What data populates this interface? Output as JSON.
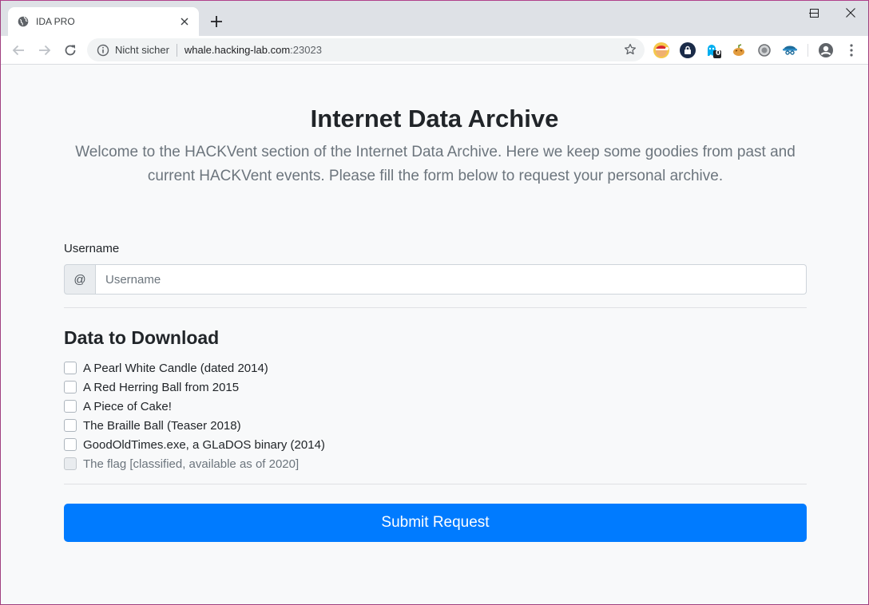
{
  "browser": {
    "tab_title": "IDA PRO",
    "security_label": "Nicht sicher",
    "url_host": "whale.hacking-lab.com",
    "url_port": ":23023",
    "extension_badge": "0"
  },
  "page": {
    "title": "Internet Data Archive",
    "lead": "Welcome to the HACKVent section of the Internet Data Archive. Here we keep some goodies from past and current HACKVent events. Please fill the form below to request your personal archive.",
    "username_label": "Username",
    "username_prepend": "@",
    "username_placeholder": "Username",
    "username_value": "",
    "download_heading": "Data to Download",
    "items": [
      {
        "label": "A Pearl White Candle (dated 2014)",
        "checked": false,
        "disabled": false
      },
      {
        "label": "A Red Herring Ball from 2015",
        "checked": false,
        "disabled": false
      },
      {
        "label": "A Piece of Cake!",
        "checked": false,
        "disabled": false
      },
      {
        "label": "The Braille Ball (Teaser 2018)",
        "checked": false,
        "disabled": false
      },
      {
        "label": "GoodOldTimes.exe, a GLaDOS binary (2014)",
        "checked": false,
        "disabled": false
      },
      {
        "label": "The flag [classified, available as of 2020]",
        "checked": false,
        "disabled": true
      }
    ],
    "submit_label": "Submit Request"
  },
  "colors": {
    "primary": "#007bff",
    "page_bg": "#f8f9fa",
    "muted_text": "#6c757d"
  }
}
